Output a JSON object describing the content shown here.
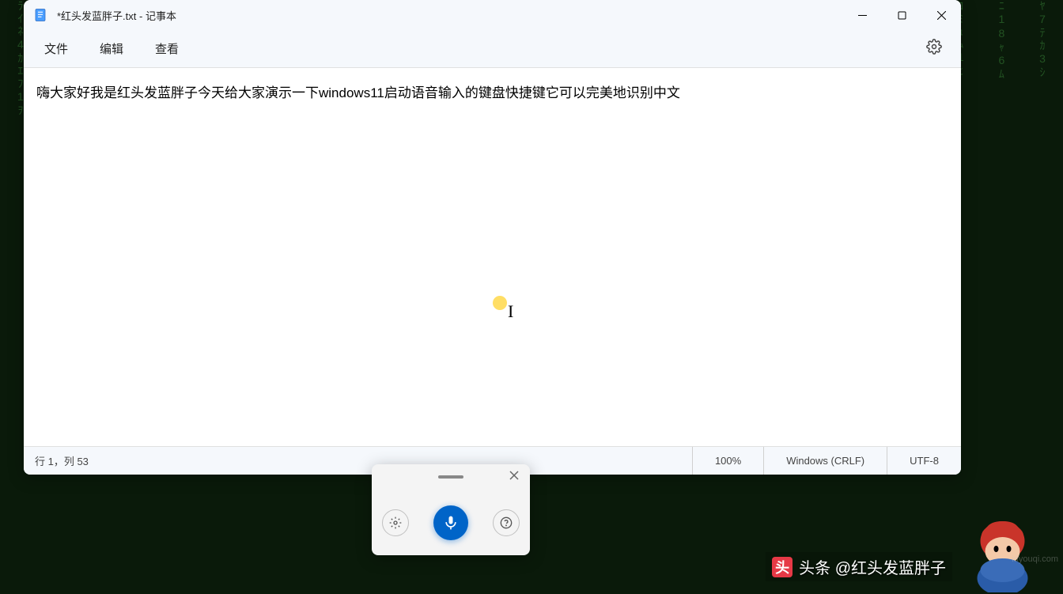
{
  "window": {
    "title": "*红头发蓝胖子.txt - 记事本",
    "controls": {
      "minimize": "minimize",
      "maximize": "maximize",
      "close": "close"
    }
  },
  "menu": {
    "file": "文件",
    "edit": "编辑",
    "view": "查看"
  },
  "content": {
    "text": "嗨大家好我是红头发蓝胖子今天给大家演示一下windows11启动语音输入的键盘快捷键它可以完美地识别中文"
  },
  "statusbar": {
    "position": "行 1，列 53",
    "zoom": "100%",
    "line_ending": "Windows (CRLF)",
    "encoding": "UTF-8"
  },
  "voice": {
    "settings": "settings",
    "mic": "microphone",
    "help": "help"
  },
  "toutiao": {
    "icon": "头",
    "label": "头条 @红头发蓝胖子"
  },
  "watermark": "idyouqi.com"
}
